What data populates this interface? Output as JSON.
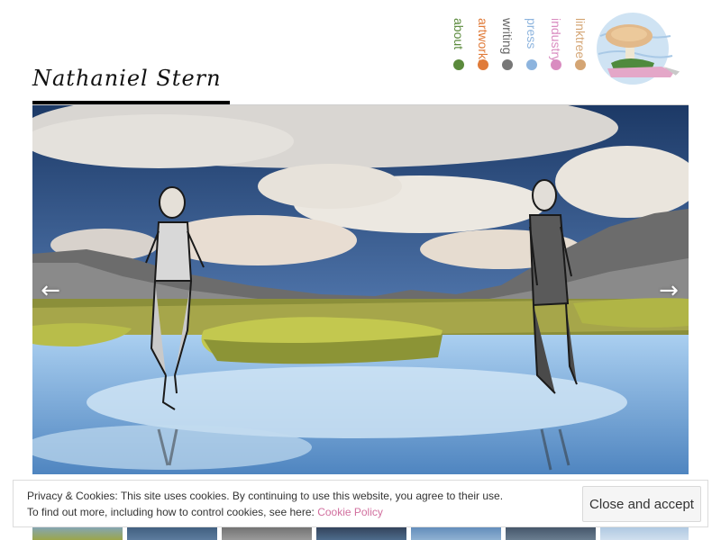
{
  "site": {
    "title": "Nathaniel Stern"
  },
  "nav": [
    {
      "label": "about",
      "color": "#5b8a3c"
    },
    {
      "label": "artworks",
      "color": "#e07b39"
    },
    {
      "label": "writing",
      "color": "#777777"
    },
    {
      "label": "press",
      "color": "#8db4de"
    },
    {
      "label": "industry",
      "color": "#d98cc0"
    },
    {
      "label": "linktree",
      "color": "#d4a574"
    }
  ],
  "logo": {
    "icon": "mushroom-island-logo-icon"
  },
  "slider": {
    "prev_icon": "←",
    "next_icon": "→"
  },
  "cookie": {
    "line1": "Privacy & Cookies: This site uses cookies. By continuing to use this website, you agree to their use.",
    "line2_prefix": "To find out more, including how to control cookies, see here: ",
    "link_label": "Cookie Policy",
    "accept_label": "Close and accept"
  }
}
